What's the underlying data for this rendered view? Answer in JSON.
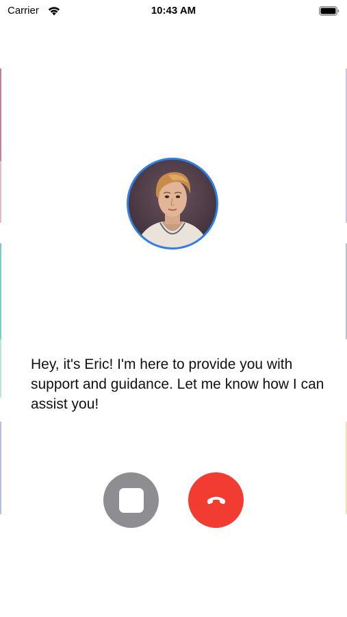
{
  "status_bar": {
    "carrier": "Carrier",
    "time": "10:43 AM",
    "wifi_icon": "wifi-icon",
    "battery_icon": "battery-full-icon"
  },
  "call": {
    "avatar_icon": "avatar",
    "avatar_ring_color": "#2f7fe8",
    "message": "Hey, it's Eric! I'm here to provide you with support and guidance. Let me know how I can assist you!",
    "controls": {
      "stop": {
        "icon": "stop-icon",
        "color": "#8e8e92"
      },
      "end_call": {
        "icon": "phone-hangup-icon",
        "color": "#f23c32"
      }
    }
  }
}
